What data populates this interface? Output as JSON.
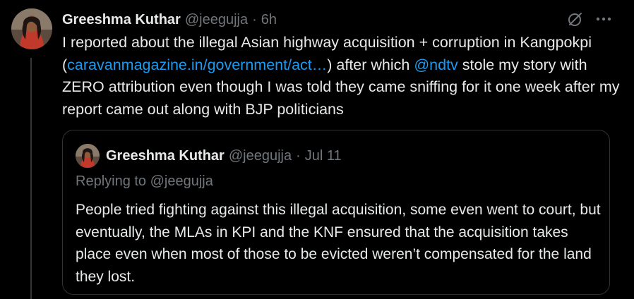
{
  "tweet": {
    "author_name": "Greeshma Kuthar",
    "handle": "@jeegujja",
    "separator": "·",
    "time": "6h",
    "text_before_link": "I reported about the illegal Asian highway acquisition + corruption in Kangpokpi (",
    "link_text": "caravanmagazine.in/government/act…",
    "text_between": ") after which ",
    "mention": "@ndtv",
    "text_after": " stole my story with ZERO attribution even though I was told they came sniffing for it one week after my report came out along with BJP politicians"
  },
  "icons": {
    "grok": "grok-icon",
    "more": "more-icon"
  },
  "quoted_tweet": {
    "author_name": "Greeshma Kuthar",
    "handle": "@jeegujja",
    "separator": "·",
    "time": "Jul 11",
    "replying_prefix": "Replying to ",
    "replying_handle": "@jeegujja",
    "text": "People tried fighting against this illegal acquisition, some even went to court, but eventually, the MLAs in KPI and the KNF ensured that the acquisition takes place even when most of those to be evicted weren’t compensated for the land they lost."
  },
  "colors": {
    "background": "#000000",
    "text": "#e7e9ea",
    "secondary": "#71767b",
    "link": "#1d9bf0",
    "border": "#2f3336"
  }
}
